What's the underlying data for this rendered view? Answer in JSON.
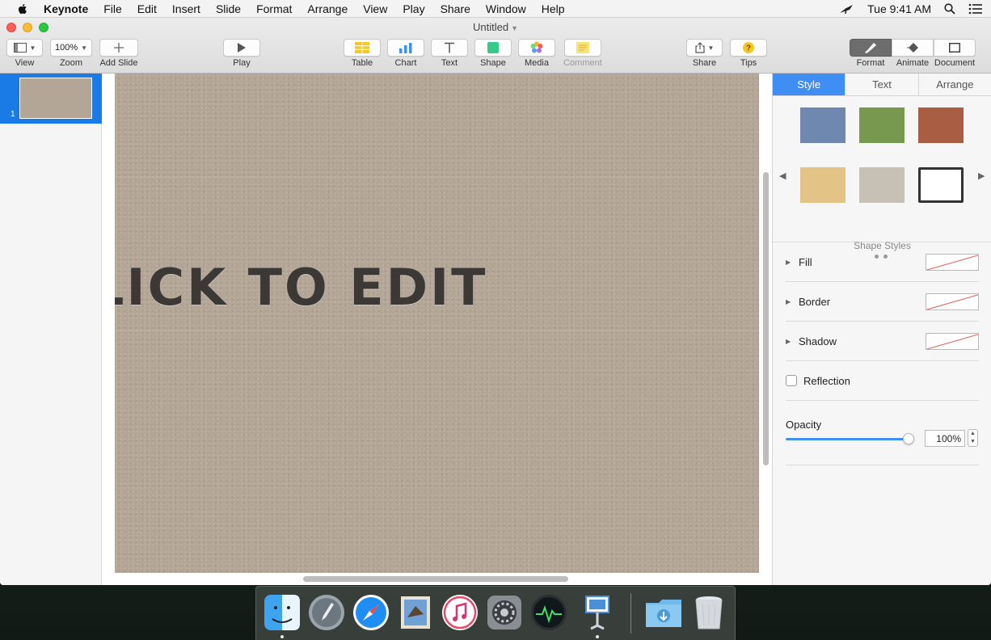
{
  "menubar": {
    "app": "Keynote",
    "items": [
      "File",
      "Edit",
      "Insert",
      "Slide",
      "Format",
      "Arrange",
      "View",
      "Play",
      "Share",
      "Window",
      "Help"
    ],
    "clock": "Tue 9:41 AM"
  },
  "window": {
    "title": "Untitled"
  },
  "toolbar": {
    "view_label": "View",
    "zoom_value": "100%",
    "zoom_label": "Zoom",
    "add_slide_label": "Add Slide",
    "play_label": "Play",
    "table_label": "Table",
    "chart_label": "Chart",
    "text_label": "Text",
    "shape_label": "Shape",
    "media_label": "Media",
    "comment_label": "Comment",
    "share_label": "Share",
    "tips_label": "Tips",
    "format_label": "Format",
    "animate_label": "Animate",
    "document_label": "Document"
  },
  "navigator": {
    "slide_number": "1"
  },
  "slide": {
    "title_text": "LICK TO EDIT",
    "background_color": "#b3a697"
  },
  "inspector": {
    "tabs": [
      "Style",
      "Text",
      "Arrange"
    ],
    "active_tab": "Style",
    "shape_styles_label": "Shape Styles",
    "swatches": [
      "#6f88b0",
      "#77994f",
      "#a95e44",
      "#e3c386",
      "#c7c0b4",
      "#ffffff"
    ],
    "fill_label": "Fill",
    "border_label": "Border",
    "shadow_label": "Shadow",
    "reflection_label": "Reflection",
    "opacity_label": "Opacity",
    "opacity_value": "100%",
    "opacity_fraction": 1.0
  },
  "dock": {
    "apps": [
      "finder-icon",
      "launchpad-icon",
      "safari-icon",
      "mail-icon",
      "itunes-icon",
      "system-preferences-icon",
      "activity-monitor-icon",
      "keynote-icon",
      "downloads-folder-icon",
      "trash-icon"
    ]
  },
  "colors": {
    "accent": "#3f8ef3",
    "selection": "#1a7ae6"
  }
}
